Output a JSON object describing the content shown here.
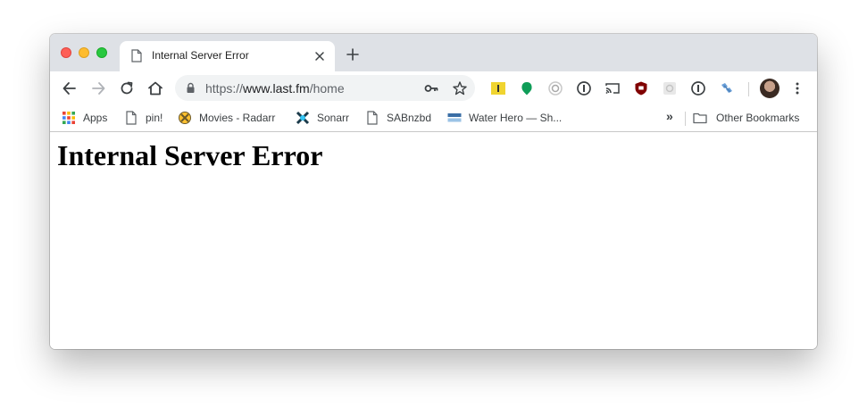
{
  "tab": {
    "title": "Internal Server Error"
  },
  "omnibox": {
    "scheme": "https://",
    "host": "www.last.fm",
    "path": "/home"
  },
  "bookmarks": {
    "items": [
      {
        "label": "Apps",
        "icon": "apps-grid-icon"
      },
      {
        "label": "pin!",
        "icon": "page-icon"
      },
      {
        "label": "Movies - Radarr",
        "icon": "radarr-icon"
      },
      {
        "label": "Sonarr",
        "icon": "sonarr-icon"
      },
      {
        "label": "SABnzbd",
        "icon": "page-icon"
      },
      {
        "label": "Water Hero — Sh...",
        "icon": "water-hero-icon"
      }
    ],
    "overflow": "»",
    "other": "Other Bookmarks"
  },
  "page": {
    "heading": "Internal Server Error"
  },
  "colors": {
    "tabstrip": "#dee1e6",
    "omnibox": "#f1f3f4",
    "close": "#fe5f57",
    "minimize": "#febc2e",
    "maximize": "#28c840"
  }
}
